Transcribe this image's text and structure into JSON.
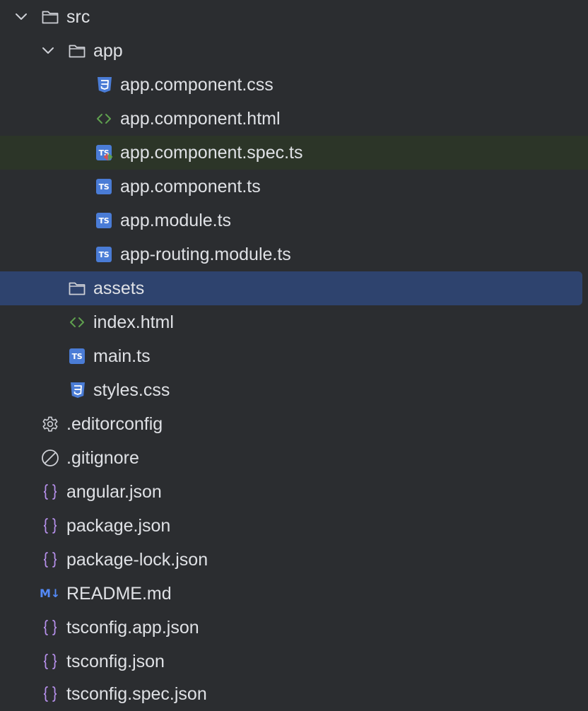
{
  "project_tree": {
    "items": [
      {
        "label": "src",
        "icon": "folder-icon",
        "expanded": true
      },
      {
        "label": "app",
        "icon": "folder-icon",
        "expanded": true
      },
      {
        "label": "app.component.css",
        "icon": "css-file-icon"
      },
      {
        "label": "app.component.html",
        "icon": "html-file-icon"
      },
      {
        "label": "app.component.spec.ts",
        "icon": "typescript-test-file-icon",
        "highlighted": true
      },
      {
        "label": "app.component.ts",
        "icon": "typescript-file-icon"
      },
      {
        "label": "app.module.ts",
        "icon": "typescript-file-icon"
      },
      {
        "label": "app-routing.module.ts",
        "icon": "typescript-file-icon"
      },
      {
        "label": "assets",
        "icon": "folder-icon",
        "selected": true
      },
      {
        "label": "index.html",
        "icon": "html-file-icon"
      },
      {
        "label": "main.ts",
        "icon": "typescript-file-icon"
      },
      {
        "label": "styles.css",
        "icon": "css-file-icon"
      },
      {
        "label": ".editorconfig",
        "icon": "gear-icon"
      },
      {
        "label": ".gitignore",
        "icon": "ignore-file-icon"
      },
      {
        "label": "angular.json",
        "icon": "json-file-icon"
      },
      {
        "label": "package.json",
        "icon": "json-file-icon"
      },
      {
        "label": "package-lock.json",
        "icon": "json-file-icon"
      },
      {
        "label": "README.md",
        "icon": "markdown-file-icon"
      },
      {
        "label": "tsconfig.app.json",
        "icon": "json-file-icon"
      },
      {
        "label": "tsconfig.json",
        "icon": "json-file-icon"
      },
      {
        "label": "tsconfig.spec.json",
        "icon": "json-file-icon"
      }
    ],
    "icon_text": {
      "ts": "TS",
      "md": "M↓"
    }
  },
  "colors": {
    "background": "#2b2d30",
    "selected_row": "#2e436e",
    "highlighted_row": "#2c3528",
    "text": "#dfe1e5",
    "typescript": "#4a7cd6",
    "css": "#4a7cd6",
    "html": "#5fa04e",
    "json": "#b48ee8",
    "markdown": "#548af7",
    "icon_gray": "#ced0d6"
  }
}
